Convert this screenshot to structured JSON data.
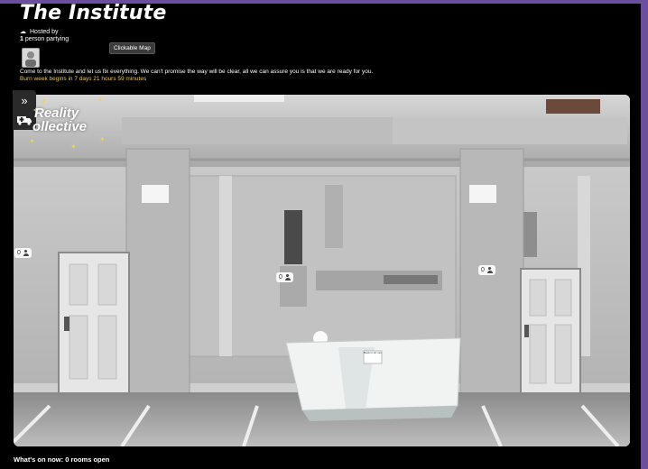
{
  "header": {
    "title": "The Institute",
    "hosted_by": "Hosted by",
    "person_count": "1",
    "person_suffix": " person partying",
    "clickable_map": "Clickable Map",
    "description": "Come to the Institute and let us fix everything. We can't promise the way will be clear, all we can assure you is that we are ready for you.",
    "burn_week": "Burn week begins in 7 days 21 hours 59 minutes"
  },
  "logo": {
    "line1": "Reality",
    "line2": "ollective"
  },
  "side_buttons": {
    "expand": "»"
  },
  "occupancy": [
    {
      "count": "0"
    },
    {
      "count": "0"
    },
    {
      "count": "0"
    }
  ],
  "desk_sign": "Back in 10 min",
  "footer": {
    "whats_on": "What's on now: 0 rooms open"
  },
  "colors": {
    "accent": "#6b4f9e",
    "burn": "#e6c65a",
    "background": "#000000"
  }
}
